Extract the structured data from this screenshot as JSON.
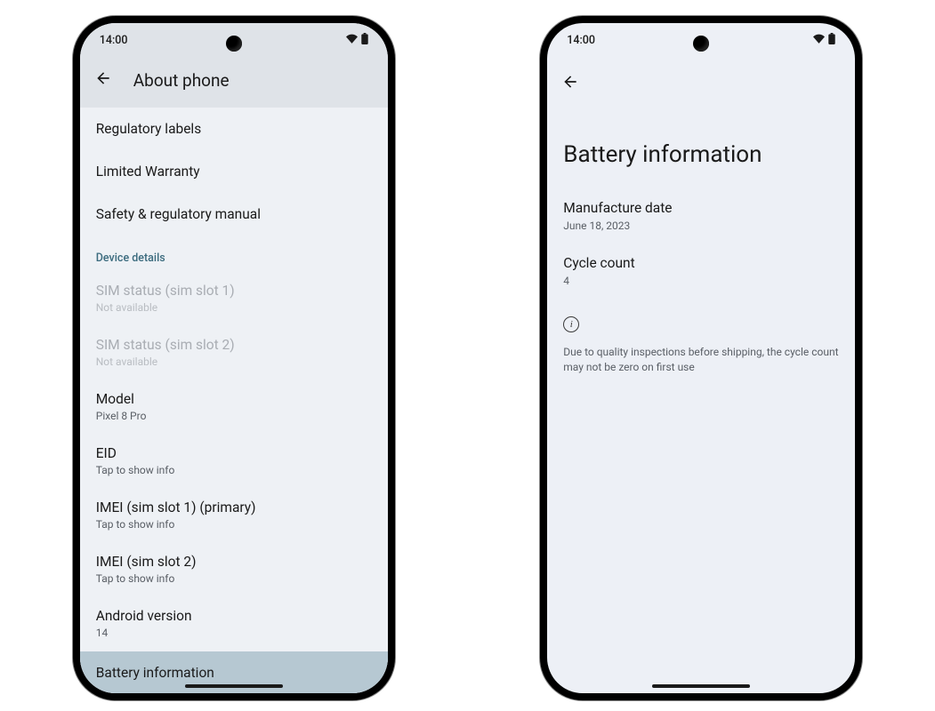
{
  "status": {
    "time": "14:00"
  },
  "screen1": {
    "header_title": "About phone",
    "items": {
      "regulatory": "Regulatory labels",
      "warranty": "Limited Warranty",
      "safety": "Safety & regulatory manual"
    },
    "section_label": "Device details",
    "sim1": {
      "title": "SIM status (sim slot 1)",
      "sub": "Not available"
    },
    "sim2": {
      "title": "SIM status (sim slot 2)",
      "sub": "Not available"
    },
    "model": {
      "title": "Model",
      "sub": "Pixel 8 Pro"
    },
    "eid": {
      "title": "EID",
      "sub": "Tap to show info"
    },
    "imei1": {
      "title": "IMEI (sim slot 1) (primary)",
      "sub": "Tap to show info"
    },
    "imei2": {
      "title": "IMEI (sim slot 2)",
      "sub": "Tap to show info"
    },
    "android": {
      "title": "Android version",
      "sub": "14"
    },
    "battery": {
      "title": "Battery information"
    }
  },
  "screen2": {
    "title": "Battery information",
    "manufacture": {
      "label": "Manufacture date",
      "value": "June 18, 2023"
    },
    "cycle": {
      "label": "Cycle count",
      "value": "4"
    },
    "note": "Due to quality inspections before shipping, the cycle count may not be zero on first use"
  }
}
